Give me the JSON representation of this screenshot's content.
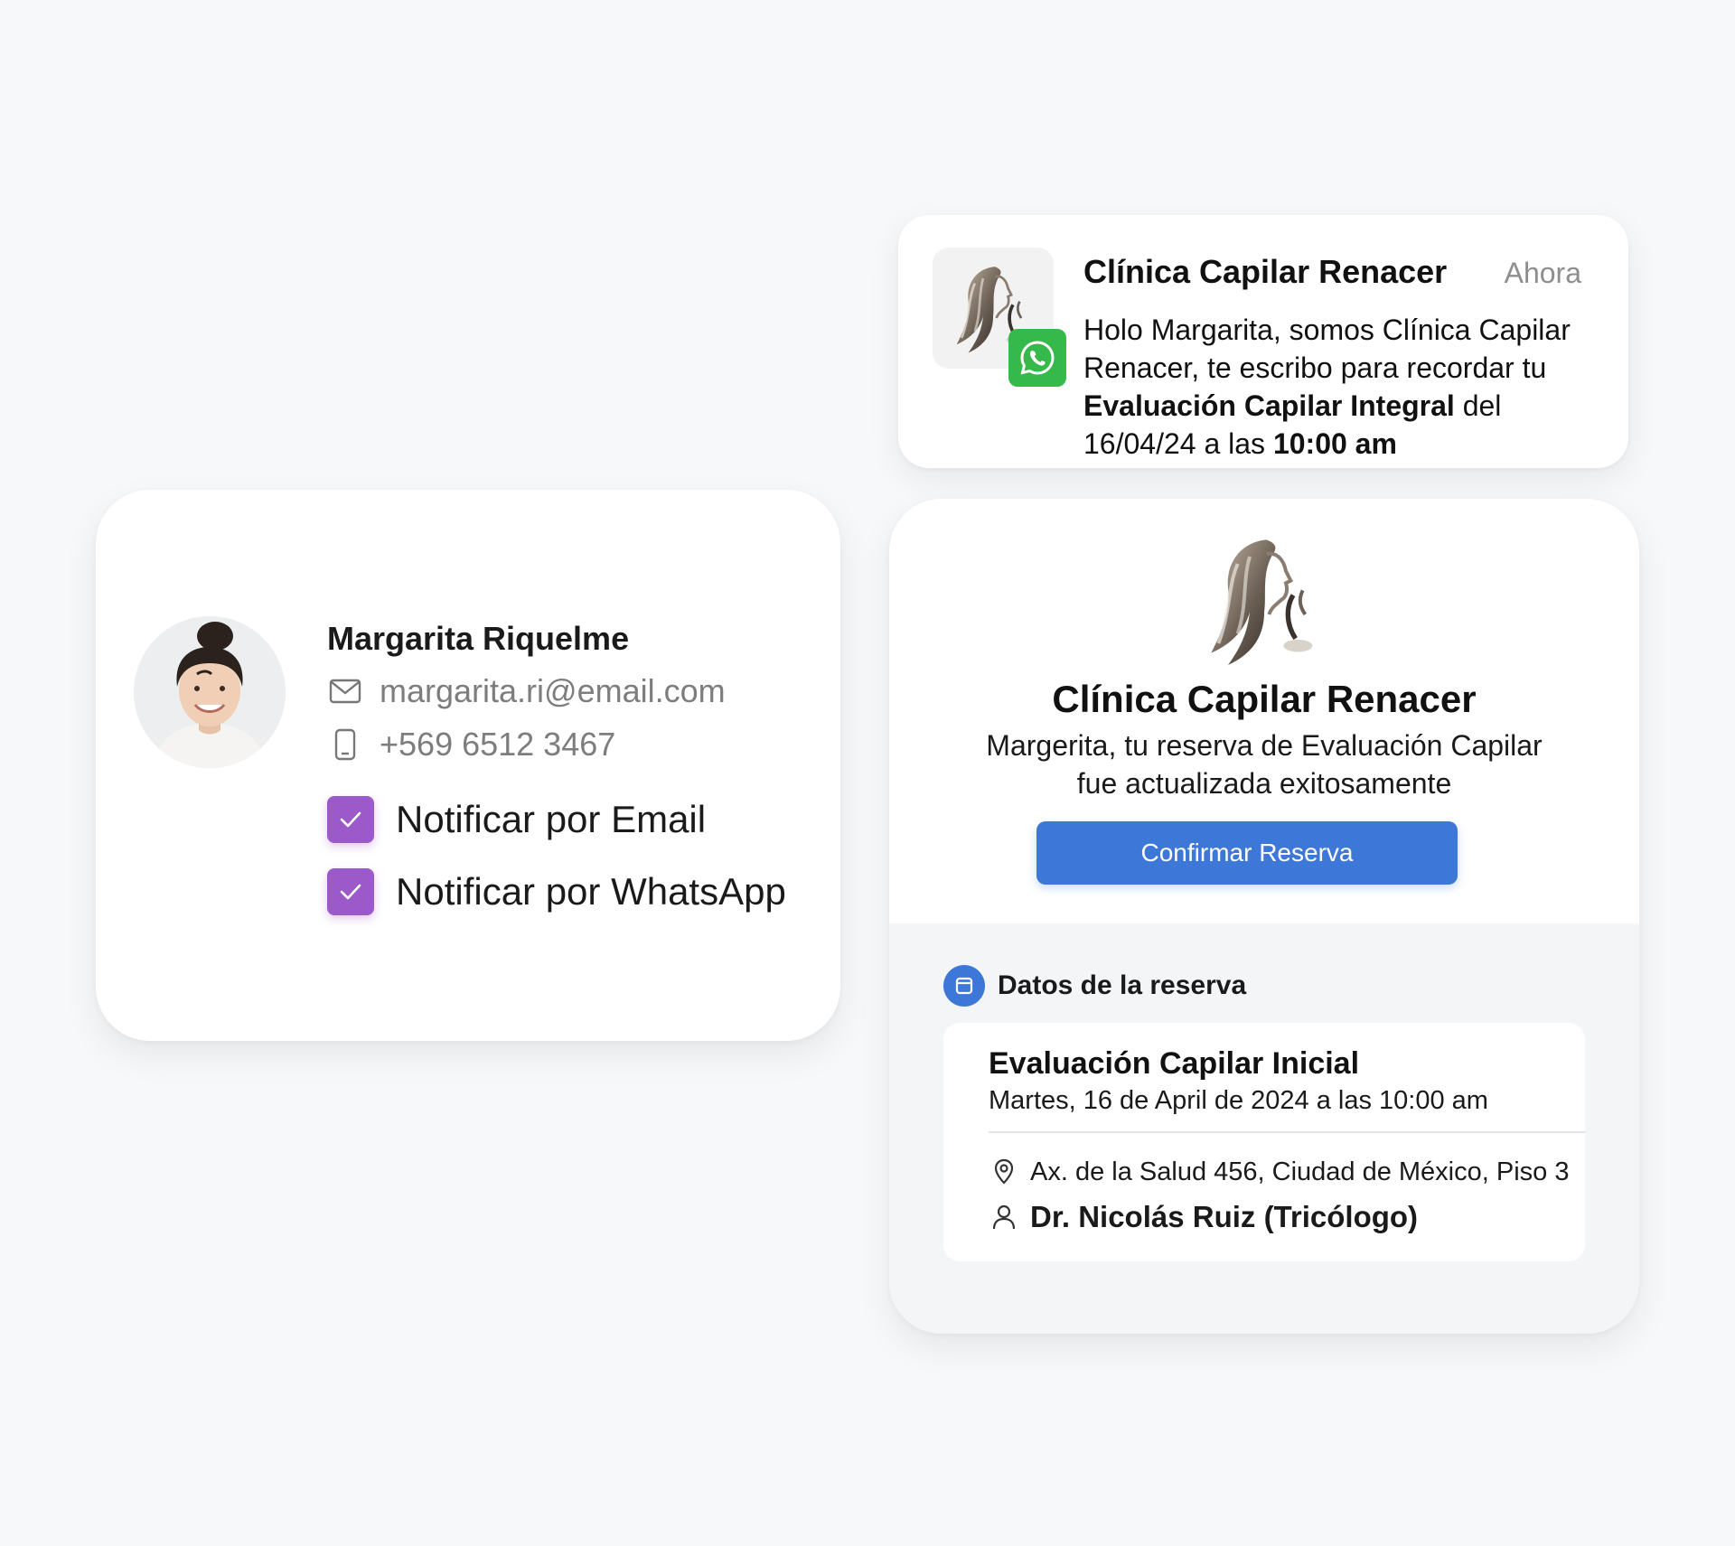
{
  "contact": {
    "name": "Margarita Riquelme",
    "email": "margarita.ri@email.com",
    "phone": "+569 6512 3467",
    "options": [
      {
        "label": "Notificar por Email",
        "checked": true
      },
      {
        "label": "Notificar por WhatsApp",
        "checked": true
      }
    ]
  },
  "notification": {
    "title": "Clínica Capilar Renacer",
    "time": "Ahora",
    "message": {
      "part1": "Holo Margarita, somos Clínica Capilar Renacer, te escribo para recordar tu ",
      "service": "Evaluación Capilar Integral",
      "part2": " del 16/04/24 a las ",
      "time": "10:00 am"
    }
  },
  "booking": {
    "clinic_name": "Clínica Capilar Renacer",
    "subtitle": "Margerita, tu reserva de Evaluación Capilar fue actualizada exitosamente",
    "confirm_label": "Confirmar Reserva",
    "section_title": "Datos de la reserva",
    "service": "Evaluación Capilar Inicial",
    "date": "Martes, 16 de April de 2024 a las 10:00 am",
    "address": "Ax. de la Salud 456, Ciudad de México, Piso 3",
    "doctor": "Dr. Nicolás Ruiz (Tricólogo)"
  },
  "colors": {
    "accent_blue": "#3d78d8",
    "checkbox_purple": "#9b59c9",
    "whatsapp_green": "#35b94a"
  },
  "icons": {
    "email": "mail-icon",
    "phone": "phone-icon",
    "check": "check-icon",
    "whatsapp": "whatsapp-icon",
    "section": "calendar-icon",
    "location": "location-pin-icon",
    "doctor": "user-icon"
  }
}
